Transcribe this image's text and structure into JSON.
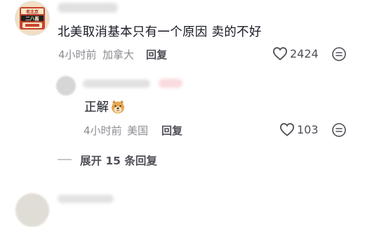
{
  "top_comment": {
    "avatar_text": [
      "老北京",
      "二八酱"
    ],
    "text": "北美取消基本只有一个原因 卖的不好",
    "time": "4小时前",
    "location": "加拿大",
    "reply_label": "回复",
    "likes": "2424"
  },
  "reply_comment": {
    "text": "正解",
    "emoji": "doge-face-icon",
    "time": "4小时前",
    "location": "美国",
    "reply_label": "回复",
    "likes": "103"
  },
  "expand_replies": "展开 15 条回复",
  "colors": {
    "text_primary": "#161823",
    "text_secondary": "#8a8b91",
    "action": "#4f5058"
  }
}
